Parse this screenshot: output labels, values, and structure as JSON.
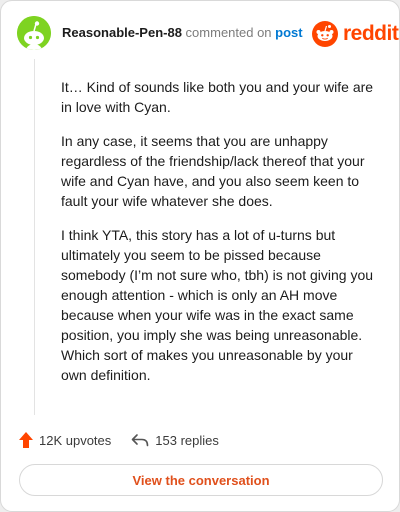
{
  "header": {
    "username": "Reasonable-Pen-88",
    "action_text": " commented on ",
    "post_link": "post",
    "brand": "reddit",
    "avatar_color": "#7ED321",
    "brand_color": "#FF4500"
  },
  "comment": {
    "paragraphs": [
      "It… Kind of sounds like both you and your wife are in love with Cyan.",
      "In any case, it seems that you are unhappy regardless of the friendship/lack thereof that your wife and Cyan have, and you also seem keen to fault your wife whatever she does.",
      "I think YTA, this story has a lot of u-turns but ultimately you seem to be pissed because somebody (I’m not sure who, tbh) is not giving you enough attention - which is only an AH move because when your wife was in the exact same position, you imply she was being unreasonable. Which sort of makes you unreasonable by your own definition."
    ]
  },
  "stats": {
    "upvotes": "12K upvotes",
    "replies": "153 replies",
    "upvote_icon": "upvote-arrow-icon",
    "reply_icon": "reply-arrow-icon"
  },
  "actions": {
    "view_label": "View the conversation"
  }
}
